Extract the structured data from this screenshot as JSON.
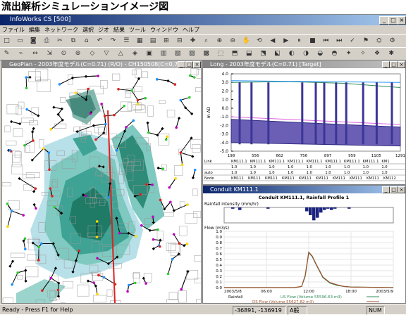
{
  "caption": "流出解析シミュレーションイメージ図",
  "app": {
    "title": "InfoWorks CS [500]",
    "menu": [
      "ファイル",
      "編集",
      "ネットワーク",
      "選択",
      "ジオ",
      "結果",
      "ツール",
      "ウィンドウ",
      "ヘルプ"
    ]
  },
  "windows": {
    "geoplan": {
      "title": "GeoPlan - 2003年度モデル(C=0.71) (R/O) - CH150508(C=0.71)(2003/5/8(Rain)"
    },
    "long": {
      "title": "Long - 2003年度モデル(C=0.71) [Target]"
    },
    "conduit": {
      "title": "Conduit KM111.1"
    }
  },
  "long_section": {
    "yticks": [
      "4.0",
      "3.0",
      "2.0",
      "1.0",
      "0.0",
      "-1.0",
      "-2.0",
      "-3.0",
      "-4.0",
      "-5.0"
    ],
    "ylabel": "m AD",
    "chainage": [
      "198",
      "556",
      "662",
      "756",
      "897",
      "959",
      "1105",
      "1291"
    ],
    "links_row": [
      "Link",
      "KM111.1",
      "KM111.1",
      "KM111.1",
      "KM111.1",
      "KM111.1",
      "KM111.1",
      "KM111.1",
      "KM111.1",
      "KM1"
    ],
    "row2": [
      "1.0",
      "1.0",
      "1.0",
      "1.0",
      "1.0",
      "1.0",
      "1.0",
      "1.0",
      "1.0"
    ],
    "row3_label": "auto",
    "row3": [
      "1.0",
      "1.0",
      "1.0",
      "1.0",
      "1.0",
      "1.0",
      "1.0",
      "1.0",
      "1.0"
    ],
    "node_label": "Node",
    "nodes": [
      "KM111",
      "KM111",
      "KM111",
      "KM111",
      "KM111",
      "KM111",
      "KM111",
      "KM111",
      "KM111",
      "KM112"
    ]
  },
  "chart_data": [
    {
      "type": "bar",
      "title": "Conduit KM111.1, Rainfall Profile 1",
      "ylabel": "Rainfall intensity (mm/hr)",
      "x": [
        0,
        1,
        2,
        3,
        4,
        5,
        6,
        7,
        8,
        9,
        10,
        11,
        12,
        13,
        14,
        15,
        16,
        17,
        18,
        19,
        20,
        21,
        22,
        23,
        24,
        25,
        26,
        27,
        28,
        29,
        30,
        31,
        32,
        33,
        34,
        35,
        36,
        37,
        38,
        39,
        40,
        41,
        42,
        43,
        44,
        45,
        46,
        47
      ],
      "values": [
        0,
        0,
        1,
        0,
        2,
        0,
        0,
        0,
        0,
        0,
        0,
        0,
        1,
        0,
        0,
        0,
        0,
        0,
        0,
        0,
        0,
        0,
        0,
        3,
        6,
        10,
        8,
        4,
        2,
        1,
        2,
        1,
        0,
        0,
        0,
        1,
        0,
        0,
        0,
        0,
        0,
        0,
        0,
        0,
        0,
        0,
        0,
        0
      ]
    },
    {
      "type": "line",
      "ylabel": "Flow (m3/s)",
      "xlabel": "",
      "yticks": [
        "1.0",
        "0.9",
        "0.8",
        "0.7",
        "0.6",
        "0.5",
        "0.4",
        "0.3",
        "0.2",
        "0.1",
        "0.0"
      ],
      "ylim": [
        0,
        1.0
      ],
      "xticks": [
        "2003/5/8",
        "06:00",
        "12:00",
        "18:00",
        "2003/5/9"
      ],
      "xlim": [
        0,
        24
      ],
      "series": [
        {
          "name": "US Flow (Volume 55596.63 m3)",
          "color": "#2e8b57",
          "x": [
            0,
            6,
            10,
            11,
            11.5,
            12,
            12.5,
            13,
            13.5,
            14,
            15,
            16,
            17,
            18,
            24
          ],
          "y": [
            0,
            0,
            0,
            0.02,
            0.2,
            0.62,
            0.55,
            0.42,
            0.3,
            0.18,
            0.08,
            0.04,
            0.02,
            0.01,
            0
          ]
        },
        {
          "name": "DS Flow (Volume 55627.82 m3)",
          "color": "#a0522d",
          "x": [
            0,
            6,
            10,
            11,
            11.5,
            12,
            12.5,
            13,
            13.5,
            14,
            15,
            16,
            17,
            18,
            24
          ],
          "y": [
            0,
            0,
            0,
            0.02,
            0.22,
            0.63,
            0.56,
            0.43,
            0.31,
            0.19,
            0.09,
            0.05,
            0.02,
            0.01,
            0
          ]
        }
      ],
      "legend_label": "Rainfall"
    }
  ],
  "status": {
    "ready": "Ready - Press F1 for Help",
    "coords": "-36891, -136919",
    "num": "NUM",
    "ime": "A般"
  }
}
